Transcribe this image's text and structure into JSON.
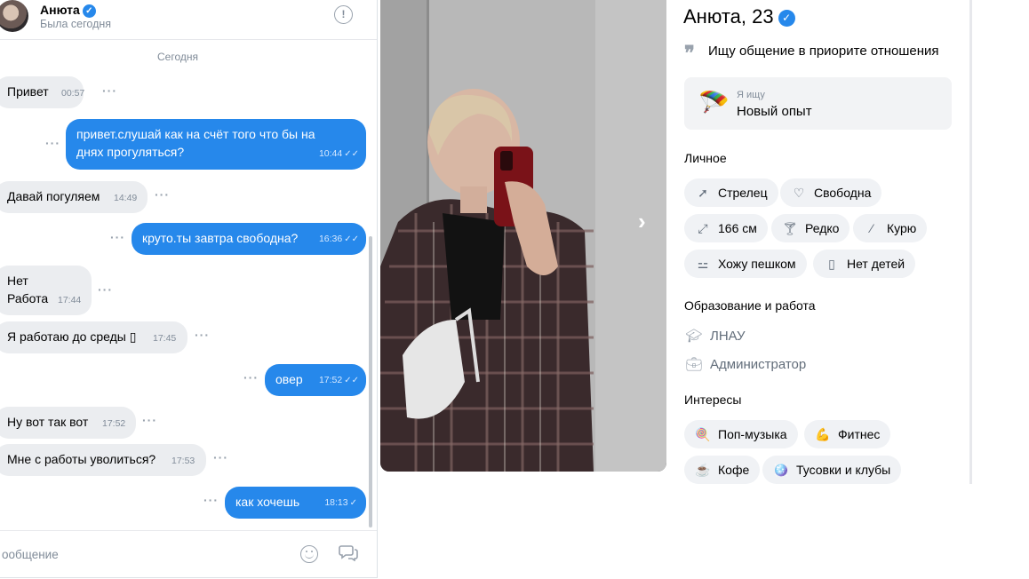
{
  "chat": {
    "header": {
      "name": "Анюта",
      "status": "Была сегодня"
    },
    "date_separator": "Сегодня",
    "messages": [
      {
        "dir": "in",
        "text": "Привет",
        "time": "00:57"
      },
      {
        "dir": "out",
        "text": "привет.слушай как на счёт того что бы на днях прогуляться?",
        "time": "10:44",
        "check": "✓✓"
      },
      {
        "dir": "in",
        "text": "Давай погуляем",
        "time": "14:49"
      },
      {
        "dir": "out",
        "text": "круто.ты завтра свободна?",
        "time": "16:36",
        "check": "✓✓"
      },
      {
        "dir": "in",
        "text": "Нет\nРабота",
        "time": "17:44"
      },
      {
        "dir": "in",
        "text": "Я работаю до среды ▯",
        "time": "17:45"
      },
      {
        "dir": "out",
        "text": "овер",
        "time": "17:52",
        "check": "✓✓"
      },
      {
        "dir": "in",
        "text": "Ну вот так вот",
        "time": "17:52"
      },
      {
        "dir": "in",
        "text": "Мне с работы уволиться?",
        "time": "17:53"
      },
      {
        "dir": "out",
        "text": "как хочешь",
        "time": "18:13",
        "check": "✓"
      }
    ],
    "composer": {
      "placeholder": "ообщение"
    }
  },
  "profile": {
    "name_age": "Анюта, 23",
    "quote": "Ищу общение в приорите отношения",
    "seeking": {
      "label": "Я ищу",
      "value": "Новый опыт"
    },
    "personal_title": "Личное",
    "personal": [
      {
        "label": "Стрелец",
        "icon": "arrow-icon"
      },
      {
        "label": "Свободна",
        "icon": "heart-icon"
      },
      {
        "label": "166 см",
        "icon": "height-icon"
      },
      {
        "label": "Редко",
        "icon": "glass-icon"
      },
      {
        "label": "Курю",
        "icon": "cigarette-icon"
      },
      {
        "label": "Хожу пешком",
        "icon": "dumbbell-icon"
      },
      {
        "label": "Нет детей",
        "icon": "baby-bottle-icon"
      }
    ],
    "education_title": "Образование и работа",
    "education": "ЛНАУ",
    "job": "Администратор",
    "interests_title": "Интересы",
    "interests": [
      {
        "label": "Поп-музыка",
        "icon": "lollipop-icon"
      },
      {
        "label": "Фитнес",
        "icon": "bicep-icon"
      },
      {
        "label": "Кофе",
        "icon": "coffee-icon"
      },
      {
        "label": "Тусовки и клубы",
        "icon": "disco-icon"
      }
    ]
  },
  "colors": {
    "accent": "#2688eb",
    "bubble_in": "#ebedf0",
    "muted": "#818c99"
  }
}
